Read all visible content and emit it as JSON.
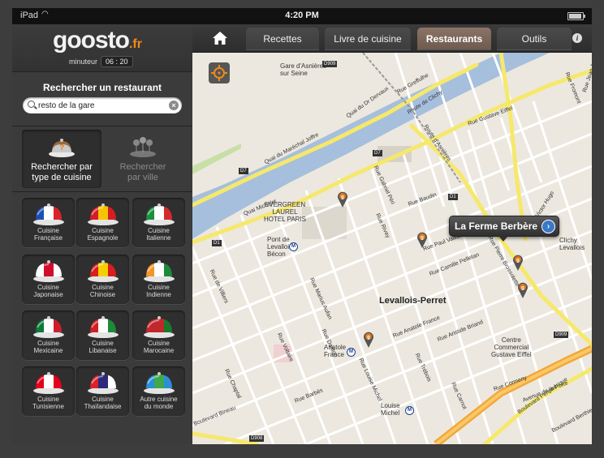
{
  "status_bar": {
    "device": "iPad",
    "time": "4:20 PM"
  },
  "sidebar": {
    "logo": "goosto",
    "logo_suffix": ".fr",
    "timer_label": "minuteur",
    "timer_value": "06 : 20",
    "search_title": "Rechercher un restaurant",
    "search_value": "resto de la gare",
    "modes": [
      {
        "label_line1": "Rechercher par",
        "label_line2": "type de cuisine",
        "active": true
      },
      {
        "label_line1": "Rechercher",
        "label_line2": "par ville",
        "active": false
      }
    ],
    "cuisines": [
      {
        "line1": "Cuisine",
        "line2": "Française",
        "icon": "france-flag-cloche-icon",
        "colors": [
          "#1e4fb5",
          "#ffffff",
          "#d8242a"
        ]
      },
      {
        "line1": "Cuisine",
        "line2": "Espagnole",
        "icon": "spain-flag-cloche-icon",
        "colors": [
          "#d41d25",
          "#f5c400",
          "#d41d25"
        ]
      },
      {
        "line1": "Cuisine",
        "line2": "Italienne",
        "icon": "italy-flag-cloche-icon",
        "colors": [
          "#1a8f3c",
          "#ffffff",
          "#d32a2a"
        ]
      },
      {
        "line1": "Cuisine",
        "line2": "Japonaise",
        "icon": "japan-flag-cloche-icon",
        "colors": [
          "#ffffff",
          "#d0102a",
          "#ffffff"
        ]
      },
      {
        "line1": "Cuisine",
        "line2": "Chinoise",
        "icon": "china-flag-cloche-icon",
        "colors": [
          "#d81e1e",
          "#f5d000",
          "#d81e1e"
        ]
      },
      {
        "line1": "Cuisine",
        "line2": "Indienne",
        "icon": "india-flag-cloche-icon",
        "colors": [
          "#f39628",
          "#ffffff",
          "#1c8a3a"
        ]
      },
      {
        "line1": "Cuisine",
        "line2": "Mexicaine",
        "icon": "mexico-flag-cloche-icon",
        "colors": [
          "#0b7a3d",
          "#ffffff",
          "#cc2030"
        ]
      },
      {
        "line1": "Cuisine",
        "line2": "Libanaise",
        "icon": "lebanon-flag-cloche-icon",
        "colors": [
          "#d21e26",
          "#ffffff",
          "#1c8a3a"
        ]
      },
      {
        "line1": "Cuisine",
        "line2": "Marocaine",
        "icon": "morocco-flag-cloche-icon",
        "colors": [
          "#c1272d",
          "#c1272d",
          "#1a7a2c"
        ]
      },
      {
        "line1": "Cuisine",
        "line2": "Tunisienne",
        "icon": "tunisia-flag-cloche-icon",
        "colors": [
          "#e3001b",
          "#ffffff",
          "#e3001b"
        ]
      },
      {
        "line1": "Cuisine",
        "line2": "Thaïlandaise",
        "icon": "thailand-flag-cloche-icon",
        "colors": [
          "#d8232a",
          "#2d2a7a",
          "#ffffff"
        ]
      },
      {
        "line1": "Autre cuisine",
        "line2": "du monde",
        "icon": "globe-cloche-icon",
        "colors": [
          "#2a8fd6",
          "#3fa84a",
          "#2a8fd6"
        ]
      }
    ]
  },
  "nav": {
    "tabs": [
      "Recettes",
      "Livre de cuisine",
      "Restaurants",
      "Outils"
    ],
    "active_tab": "Restaurants"
  },
  "map": {
    "callout": "La Ferme Berbère",
    "city": "Levallois-Perret",
    "places": {
      "gare": "Gare d'Asnières",
      "seine": "sur Seine",
      "hotel": "EVERGREEN\nLAUREL\nHOTEL PARIS",
      "pont": "Pont de\nLevallois\nBécon",
      "anatole": "Anatole\nFrance",
      "louise": "Louise\nMichel",
      "centre": "Centre\nCommercial\nGustave Eiffel",
      "clichy": "Clichy\nLevallois"
    },
    "roads": [
      "D7",
      "D7",
      "D1",
      "D1",
      "D908",
      "D909",
      "D909"
    ],
    "streets": [
      "Quai Michelet",
      "Quai du Maréchal Joffre",
      "Quai du Dr Dervaux",
      "Route de Clichy",
      "Route d'Asnières",
      "Rue Victor Hugo",
      "Rue Baudin",
      "Rue Camille Pelletan",
      "Rue Aristide Briand",
      "Boulevard Périphérique",
      "Boulevard Bineau",
      "Rue Gustave Eiffel",
      "Rue Paul Vaillant-Couturier",
      "Rue Pierre Brossolette",
      "Rue Marius Aufan",
      "Rue de Villiers",
      "Rue Chaptal",
      "Rue Voltaire",
      "Rue Jean Jaurès",
      "Rue Fromont",
      "Boulevard Berthier",
      "Rue Rivay",
      "Rue Gabriel Péri",
      "Rue Anatole France",
      "Rue Louise Michel",
      "Rue Danton",
      "Rue Cormeny",
      "Avenue de la Porte",
      "Rue Trébois",
      "Rue Barbès",
      "Rue Carnot",
      "Rue Greffulhe"
    ]
  }
}
